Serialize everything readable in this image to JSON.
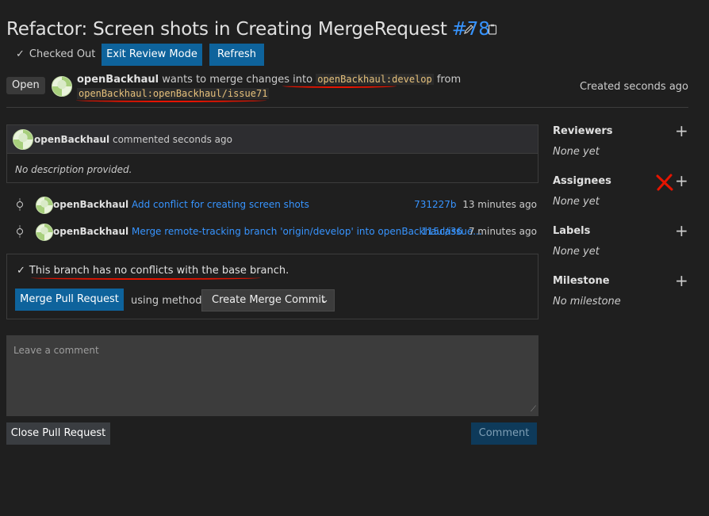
{
  "header": {
    "title": "Refactor: Screen shots in Creating MergeRequest",
    "number": "#78",
    "checked_out": "Checked Out",
    "exit_review_mode": "Exit Review Mode",
    "refresh": "Refresh"
  },
  "status": {
    "badge": "Open",
    "author": "openBackhaul",
    "wants_text": "wants to merge changes into",
    "target_branch": "openBackhaul:develop",
    "from_text": "from",
    "source_branch": "openBackhaul:openBackhaul/issue71",
    "created": "Created seconds ago"
  },
  "description": {
    "author": "openBackhaul",
    "action": "commented seconds ago",
    "body": "No description provided."
  },
  "commits": [
    {
      "author": "openBackhaul",
      "message": "Add conflict for creating screen shots",
      "sha": "731227b",
      "time": "13 minutes ago"
    },
    {
      "author": "openBackhaul",
      "message": "Merge remote-tracking branch 'origin/develop' into openBackhaul/issue...",
      "sha": "115ca36",
      "time": "7 minutes ago"
    }
  ],
  "merge": {
    "status": "This branch has no conflicts with the base branch.",
    "merge_button": "Merge Pull Request",
    "using_method": "using method",
    "method": "Create Merge Commit"
  },
  "comment": {
    "placeholder": "Leave a comment",
    "close_button": "Close Pull Request",
    "comment_button": "Comment"
  },
  "sidebar": {
    "reviewers": {
      "title": "Reviewers",
      "value": "None yet"
    },
    "assignees": {
      "title": "Assignees",
      "value": "None yet"
    },
    "labels": {
      "title": "Labels",
      "value": "None yet"
    },
    "milestone": {
      "title": "Milestone",
      "value": "No milestone"
    }
  },
  "colors": {
    "background": "#1f1f1f",
    "primary_button": "#0e639c",
    "link": "#3794ff",
    "annotation_red": "#e51400",
    "branch_code": "#e5c07b"
  }
}
